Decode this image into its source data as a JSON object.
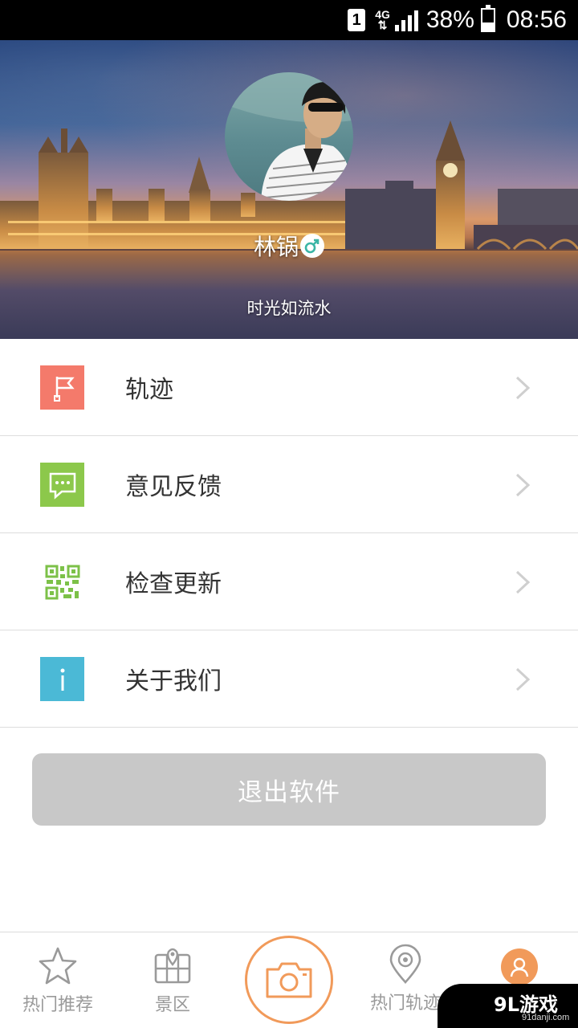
{
  "status_bar": {
    "sim": "1",
    "network": "4G",
    "battery": "38%",
    "time": "08:56",
    "battery_level": 0.38
  },
  "profile": {
    "name": "林锅",
    "gender_icon": "male-symbol-icon",
    "motto": "时光如流水"
  },
  "menu": [
    {
      "label": "轨迹",
      "icon": "flag-icon",
      "color": "#f47a6b"
    },
    {
      "label": "意见反馈",
      "icon": "message-icon",
      "color": "#8cc84b"
    },
    {
      "label": "检查更新",
      "icon": "qr-code-icon",
      "color": "#7cc148"
    },
    {
      "label": "关于我们",
      "icon": "info-icon",
      "color": "#4bb9d6"
    }
  ],
  "logout_label": "退出软件",
  "tabs": [
    {
      "label": "热门推荐",
      "icon": "star-icon"
    },
    {
      "label": "景区",
      "icon": "map-icon"
    },
    {
      "label": "",
      "icon": "camera-icon"
    },
    {
      "label": "热门轨迹",
      "icon": "location-pin-icon"
    },
    {
      "label": "",
      "icon": "user-icon",
      "active": true
    }
  ],
  "colors": {
    "accent": "#f19a5a",
    "tab_text": "#9a9a9a",
    "logout_bg": "#c8c8c8"
  },
  "watermark": {
    "brand": "9L游戏",
    "site": "91danji.com"
  }
}
